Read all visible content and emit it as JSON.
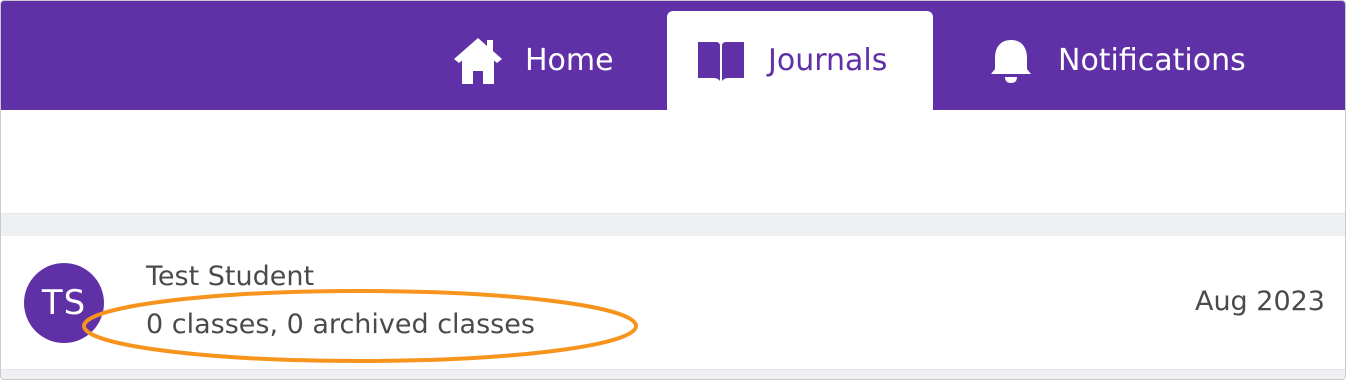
{
  "nav": {
    "tabs": [
      {
        "label": "Home",
        "icon": "home-icon",
        "active": false
      },
      {
        "label": "Journals",
        "icon": "book-icon",
        "active": true
      },
      {
        "label": "Notifications",
        "icon": "bell-icon",
        "active": false
      }
    ]
  },
  "student": {
    "initials": "TS",
    "name": "Test Student",
    "meta": "0 classes, 0 archived classes",
    "date": "Aug 2023"
  },
  "colors": {
    "brand": "#6030a7",
    "highlight": "#f7941d",
    "text": "#4a4a4a",
    "band": "#eef0f2"
  }
}
